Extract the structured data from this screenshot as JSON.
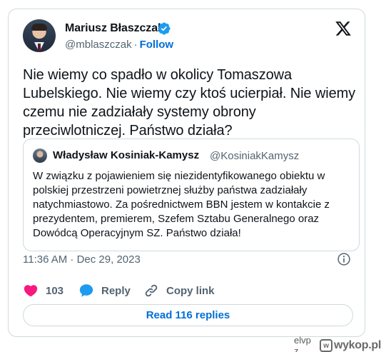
{
  "tweet": {
    "author_name": "Mariusz Błaszczak",
    "handle": "@mblaszczak",
    "separator": "·",
    "follow_label": "Follow",
    "text": "Nie wiemy co spadło w okolicy Tomaszowa Lubelskiego. Nie wiemy czy ktoś ucierpiał. Nie wiemy czemu nie zadziałały systemy obrony przeciwlotniczej. Państwo działa?",
    "timestamp": "11:36 AM · Dec 29, 2023",
    "likes": "103",
    "reply_label": "Reply",
    "copy_link_label": "Copy link",
    "read_replies_label": "Read 116 replies"
  },
  "quote": {
    "author_name": "Władysław Kosiniak-Kamysz",
    "handle": "@KosiniakKamysz",
    "text": "W związku z pojawieniem się niezidentyfikowanego obiektu w polskiej przestrzeni powietrznej służby państwa zadziałały natychmiastowo. Za pośrednictwem BBN jestem w kontakcie z prezydentem, premierem, Szefem Sztabu Generalnego oraz Dowódcą Operacyjnym SZ. Państwo działa!"
  },
  "watermark": {
    "user": "elvp",
    "user_suffix": "z",
    "site": "wykop.pl"
  },
  "icons": {
    "verified": "verified-badge-icon",
    "x_logo": "x-logo-icon",
    "info": "info-icon",
    "like": "heart-icon",
    "reply": "speech-bubble-icon",
    "copy": "link-icon"
  },
  "colors": {
    "accent": "#006fd6",
    "like": "#f91880",
    "reply": "#1d9bf0",
    "text": "#0f1419",
    "muted": "#536471",
    "border": "#cfd9de"
  }
}
